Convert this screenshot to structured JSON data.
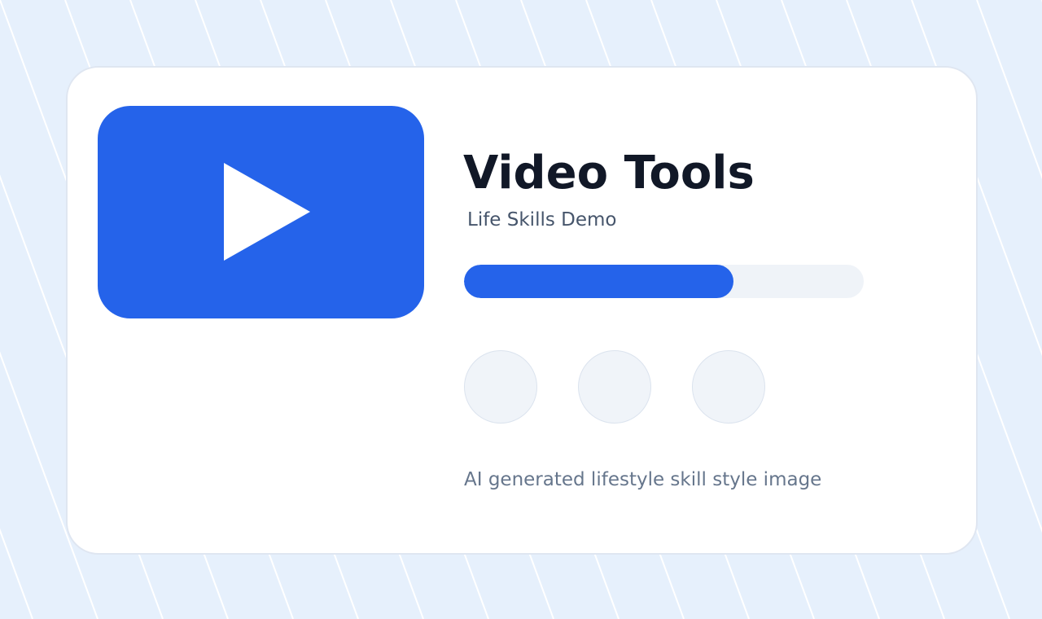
{
  "background": {
    "color": "#e6f0fc",
    "stripe_color": "#ffffff"
  },
  "card": {
    "color": "#ffffff",
    "border_color": "#dfe6f1"
  },
  "video_tile": {
    "color": "#2563ea",
    "icon": "play-icon"
  },
  "title": "Video Tools",
  "subtitle": "Life Skills Demo",
  "progress": {
    "value": 0.675,
    "fill_color": "#2563ea",
    "track_color": "#eff3f8"
  },
  "action_buttons": [
    {
      "name": "circle-button-1"
    },
    {
      "name": "circle-button-2"
    },
    {
      "name": "circle-button-3"
    }
  ],
  "caption": "AI generated lifestyle skill style image"
}
